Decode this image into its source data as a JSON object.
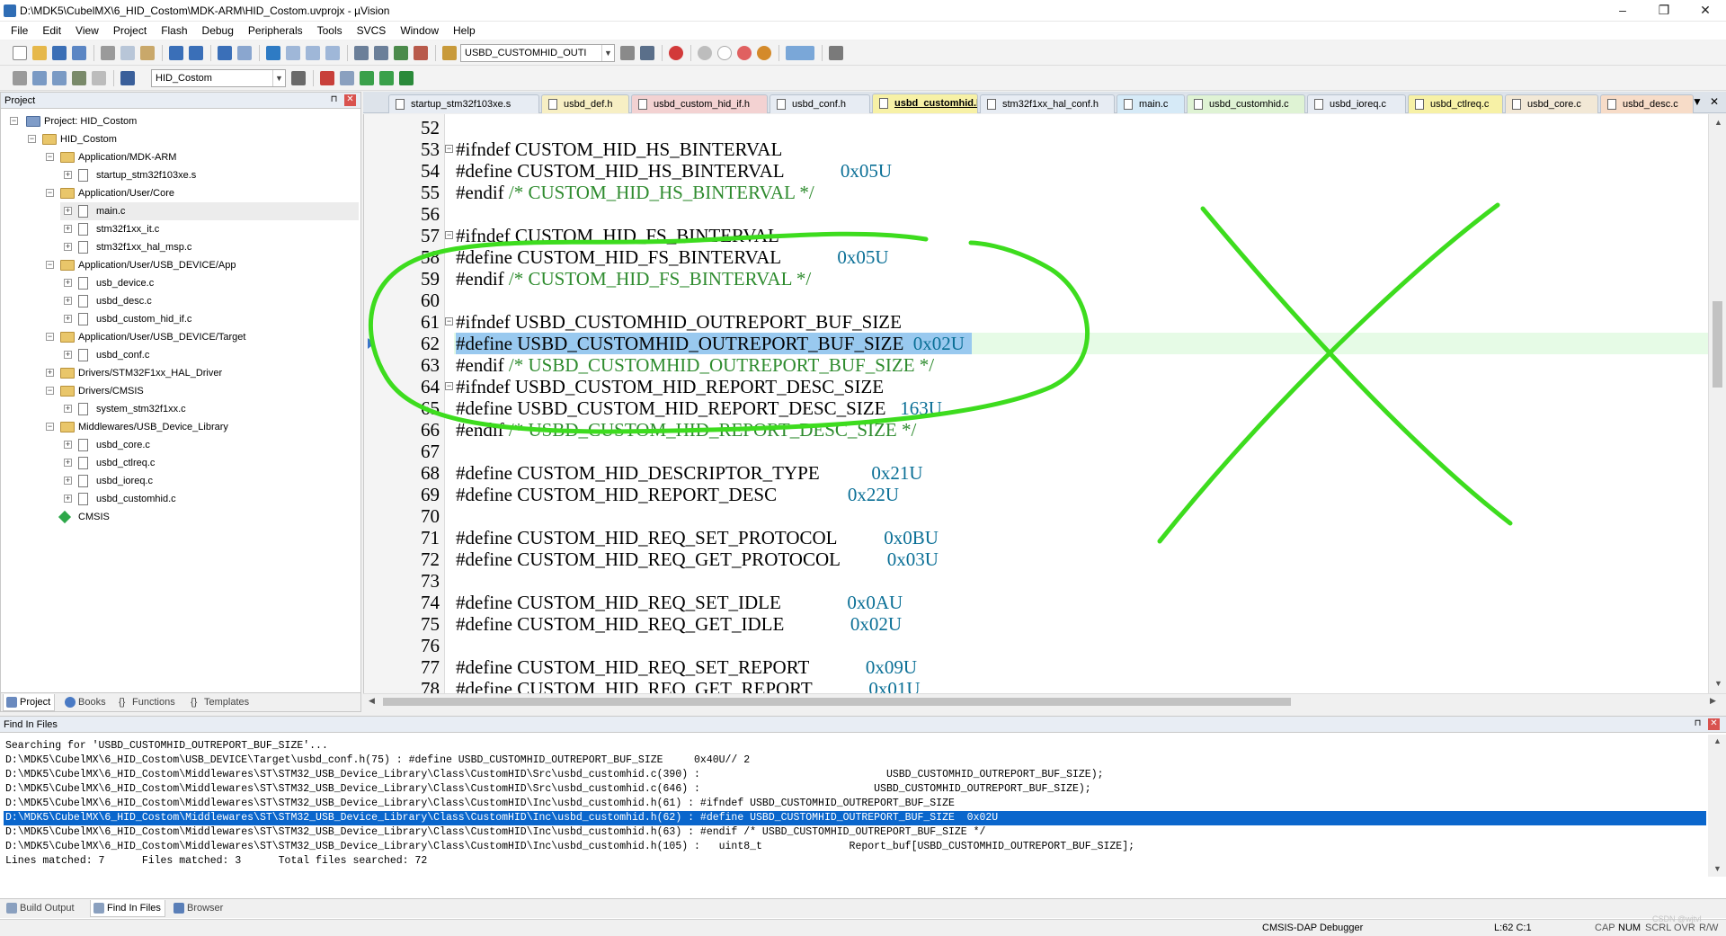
{
  "window": {
    "title": "D:\\MDK5\\CubelMX\\6_HID_Costom\\MDK-ARM\\HID_Costom.uvprojx - µVision",
    "min": "–",
    "max": "❐",
    "close": "✕"
  },
  "menu": [
    "File",
    "Edit",
    "View",
    "Project",
    "Flash",
    "Debug",
    "Peripherals",
    "Tools",
    "SVCS",
    "Window",
    "Help"
  ],
  "toolbar": {
    "find_combo": "USBD_CUSTOMHID_OUTI",
    "target_combo": "HID_Costom"
  },
  "project": {
    "header": "Project",
    "root": "Project: HID_Costom",
    "target": "HID_Costom",
    "groups": [
      {
        "name": "Application/MDK-ARM",
        "files": [
          "startup_stm32f103xe.s"
        ]
      },
      {
        "name": "Application/User/Core",
        "files": [
          "main.c",
          "stm32f1xx_it.c",
          "stm32f1xx_hal_msp.c"
        ]
      },
      {
        "name": "Application/User/USB_DEVICE/App",
        "files": [
          "usb_device.c",
          "usbd_desc.c",
          "usbd_custom_hid_if.c"
        ]
      },
      {
        "name": "Application/User/USB_DEVICE/Target",
        "files": [
          "usbd_conf.c"
        ]
      },
      {
        "name": "Drivers/STM32F1xx_HAL_Driver",
        "files": []
      },
      {
        "name": "Drivers/CMSIS",
        "files": [
          "system_stm32f1xx.c"
        ]
      },
      {
        "name": "Middlewares/USB_Device_Library",
        "files": [
          "usbd_core.c",
          "usbd_ctlreq.c",
          "usbd_ioreq.c",
          "usbd_customhid.c"
        ]
      }
    ],
    "cmsis": "CMSIS",
    "tabs": [
      "Project",
      "Books",
      "Functions",
      "Templates"
    ]
  },
  "editor_tabs": [
    {
      "label": "startup_stm32f103xe.s",
      "color": "#e7ecf3"
    },
    {
      "label": "usbd_def.h",
      "color": "#f7efc4"
    },
    {
      "label": "usbd_custom_hid_if.h",
      "color": "#f3d2d2"
    },
    {
      "label": "usbd_conf.h",
      "color": "#e7ecf3"
    },
    {
      "label": "usbd_customhid.h",
      "color": "#f7f1a6"
    },
    {
      "label": "stm32f1xx_hal_conf.h",
      "color": "#e7ecf3"
    },
    {
      "label": "main.c",
      "color": "#d6eaf7"
    },
    {
      "label": "usbd_customhid.c",
      "color": "#dff3d4"
    },
    {
      "label": "usbd_ioreq.c",
      "color": "#e7ecf3"
    },
    {
      "label": "usbd_ctlreq.c",
      "color": "#f7f1a6"
    },
    {
      "label": "usbd_core.c",
      "color": "#f2e8d6"
    },
    {
      "label": "usbd_desc.c",
      "color": "#f7dcc8"
    }
  ],
  "code": [
    {
      "n": "52",
      "text": "",
      "cmt": "",
      "num": ""
    },
    {
      "n": "53",
      "text": "#ifndef CUSTOM_HID_HS_BINTERVAL",
      "cmt": "",
      "num": ""
    },
    {
      "n": "54",
      "text": "#define CUSTOM_HID_HS_BINTERVAL            ",
      "cmt": "",
      "num": "0x05U"
    },
    {
      "n": "55",
      "text": "#endif ",
      "cmt": "/* CUSTOM_HID_HS_BINTERVAL */",
      "num": ""
    },
    {
      "n": "56",
      "text": "",
      "cmt": "",
      "num": ""
    },
    {
      "n": "57",
      "text": "#ifndef CUSTOM_HID_FS_BINTERVAL",
      "cmt": "",
      "num": ""
    },
    {
      "n": "58",
      "text": "#define CUSTOM_HID_FS_BINTERVAL            ",
      "cmt": "",
      "num": "0x05U"
    },
    {
      "n": "59",
      "text": "#endif ",
      "cmt": "/* CUSTOM_HID_FS_BINTERVAL */",
      "num": ""
    },
    {
      "n": "60",
      "text": "",
      "cmt": "",
      "num": ""
    },
    {
      "n": "61",
      "text": "#ifndef USBD_CUSTOMHID_OUTREPORT_BUF_SIZE",
      "cmt": "",
      "num": ""
    },
    {
      "n": "62",
      "text": "#define USBD_CUSTOMHID_OUTREPORT_BUF_SIZE  ",
      "cmt": "",
      "num": "0x02U"
    },
    {
      "n": "63",
      "text": "#endif ",
      "cmt": "/* USBD_CUSTOMHID_OUTREPORT_BUF_SIZE */",
      "num": ""
    },
    {
      "n": "64",
      "text": "#ifndef USBD_CUSTOM_HID_REPORT_DESC_SIZE",
      "cmt": "",
      "num": ""
    },
    {
      "n": "65",
      "text": "#define USBD_CUSTOM_HID_REPORT_DESC_SIZE   ",
      "cmt": "",
      "num": "163U"
    },
    {
      "n": "66",
      "text": "#endif ",
      "cmt": "/* USBD_CUSTOM_HID_REPORT_DESC_SIZE */",
      "num": ""
    },
    {
      "n": "67",
      "text": "",
      "cmt": "",
      "num": ""
    },
    {
      "n": "68",
      "text": "#define CUSTOM_HID_DESCRIPTOR_TYPE           ",
      "cmt": "",
      "num": "0x21U"
    },
    {
      "n": "69",
      "text": "#define CUSTOM_HID_REPORT_DESC               ",
      "cmt": "",
      "num": "0x22U"
    },
    {
      "n": "70",
      "text": "",
      "cmt": "",
      "num": ""
    },
    {
      "n": "71",
      "text": "#define CUSTOM_HID_REQ_SET_PROTOCOL          ",
      "cmt": "",
      "num": "0x0BU"
    },
    {
      "n": "72",
      "text": "#define CUSTOM_HID_REQ_GET_PROTOCOL          ",
      "cmt": "",
      "num": "0x03U"
    },
    {
      "n": "73",
      "text": "",
      "cmt": "",
      "num": ""
    },
    {
      "n": "74",
      "text": "#define CUSTOM_HID_REQ_SET_IDLE              ",
      "cmt": "",
      "num": "0x0AU"
    },
    {
      "n": "75",
      "text": "#define CUSTOM_HID_REQ_GET_IDLE              ",
      "cmt": "",
      "num": "0x02U"
    },
    {
      "n": "76",
      "text": "",
      "cmt": "",
      "num": ""
    },
    {
      "n": "77",
      "text": "#define CUSTOM_HID_REQ_SET_REPORT            ",
      "cmt": "",
      "num": "0x09U"
    },
    {
      "n": "78",
      "text": "#define CUSTOM_HID_REQ_GET_REPORT            ",
      "cmt": "",
      "num": "0x01U"
    }
  ],
  "find": {
    "header": "Find In Files",
    "lines": [
      "Searching for 'USBD_CUSTOMHID_OUTREPORT_BUF_SIZE'...",
      "D:\\MDK5\\CubelMX\\6_HID_Costom\\USB_DEVICE\\Target\\usbd_conf.h(75) : #define USBD_CUSTOMHID_OUTREPORT_BUF_SIZE     0x40U// 2",
      "D:\\MDK5\\CubelMX\\6_HID_Costom\\Middlewares\\ST\\STM32_USB_Device_Library\\Class\\CustomHID\\Src\\usbd_customhid.c(390) :                              USBD_CUSTOMHID_OUTREPORT_BUF_SIZE);",
      "D:\\MDK5\\CubelMX\\6_HID_Costom\\Middlewares\\ST\\STM32_USB_Device_Library\\Class\\CustomHID\\Src\\usbd_customhid.c(646) :                            USBD_CUSTOMHID_OUTREPORT_BUF_SIZE);",
      "D:\\MDK5\\CubelMX\\6_HID_Costom\\Middlewares\\ST\\STM32_USB_Device_Library\\Class\\CustomHID\\Inc\\usbd_customhid.h(61) : #ifndef USBD_CUSTOMHID_OUTREPORT_BUF_SIZE",
      "D:\\MDK5\\CubelMX\\6_HID_Costom\\Middlewares\\ST\\STM32_USB_Device_Library\\Class\\CustomHID\\Inc\\usbd_customhid.h(62) : #define USBD_CUSTOMHID_OUTREPORT_BUF_SIZE  0x02U",
      "D:\\MDK5\\CubelMX\\6_HID_Costom\\Middlewares\\ST\\STM32_USB_Device_Library\\Class\\CustomHID\\Inc\\usbd_customhid.h(63) : #endif /* USBD_CUSTOMHID_OUTREPORT_BUF_SIZE */",
      "D:\\MDK5\\CubelMX\\6_HID_Costom\\Middlewares\\ST\\STM32_USB_Device_Library\\Class\\CustomHID\\Inc\\usbd_customhid.h(105) :   uint8_t              Report_buf[USBD_CUSTOMHID_OUTREPORT_BUF_SIZE];",
      "Lines matched: 7      Files matched: 3      Total files searched: 72"
    ],
    "selected_index": 5,
    "tabs": [
      "Build Output",
      "Find In Files",
      "Browser"
    ]
  },
  "status": {
    "debugger": "CMSIS-DAP Debugger",
    "pos": "L:62 C:1",
    "cap": "CAP",
    "num": "NUM",
    "scrl": "SCRL",
    "ovr": "OVR",
    "rw": "R/W",
    "watermark": "CSDN @wjtvl"
  },
  "annotation_color": "#3ddc1e"
}
